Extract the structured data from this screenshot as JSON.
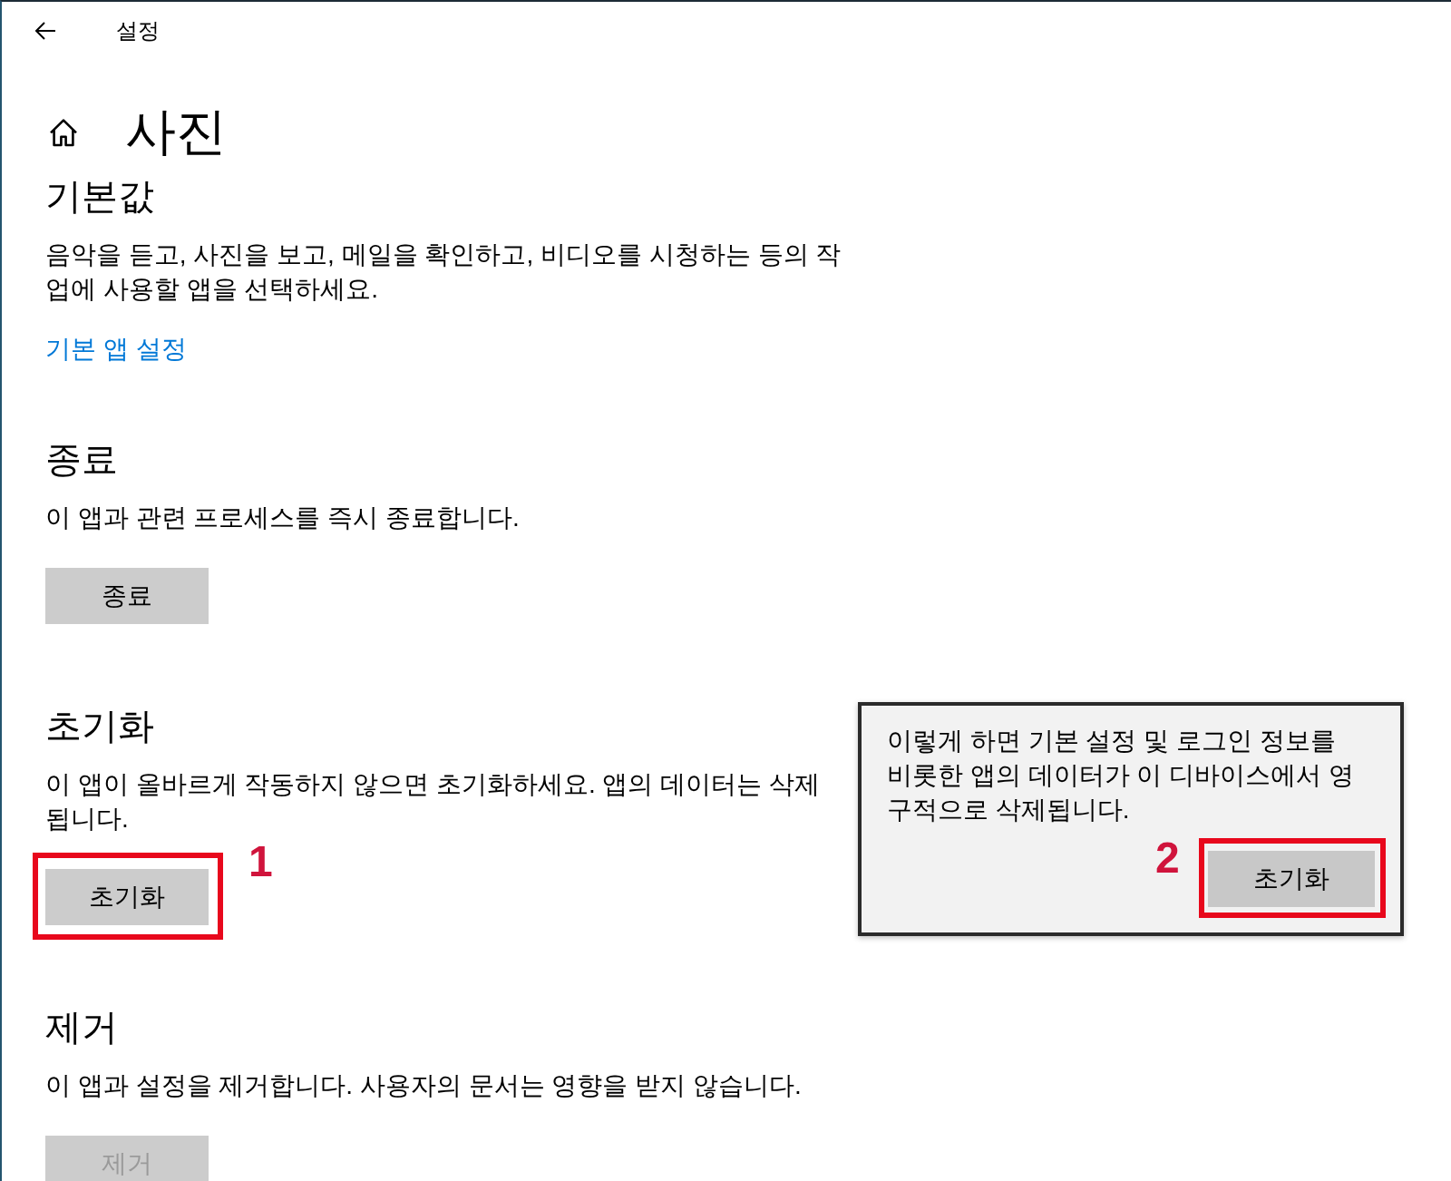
{
  "window": {
    "title": "설정"
  },
  "page": {
    "title": "사진"
  },
  "sections": [
    {
      "kind": "link",
      "heading": "기본값",
      "description": "음악을 듣고, 사진을 보고, 메일을 확인하고, 비디오를 시청하는 등의 작업에 사용할 앱을 선택하세요.",
      "link": "기본 앱 설정"
    },
    {
      "kind": "button",
      "heading": "종료",
      "description": "이 앱과 관련 프로세스를 즉시 종료합니다.",
      "button": {
        "label": "종료",
        "disabled": false
      }
    },
    {
      "kind": "button",
      "heading": "초기화",
      "description": "이 앱이 올바르게 작동하지 않으면 초기화하세요. 앱의 데이터는 삭제됩니다.",
      "button": {
        "label": "초기화",
        "disabled": false,
        "annotation": "1"
      }
    },
    {
      "kind": "button",
      "heading": "제거",
      "description": "이 앱과 설정을 제거합니다. 사용자의 문서는 영향을 받지 않습니다.",
      "button": {
        "label": "제거",
        "disabled": true
      }
    }
  ],
  "flyout": {
    "message": "이렇게 하면 기본 설정 및 로그인 정보를 비롯한 앱의 데이터가 이 디바이스에서 영구적으로 삭제됩니다.",
    "button": {
      "label": "초기화",
      "annotation": "2"
    }
  }
}
